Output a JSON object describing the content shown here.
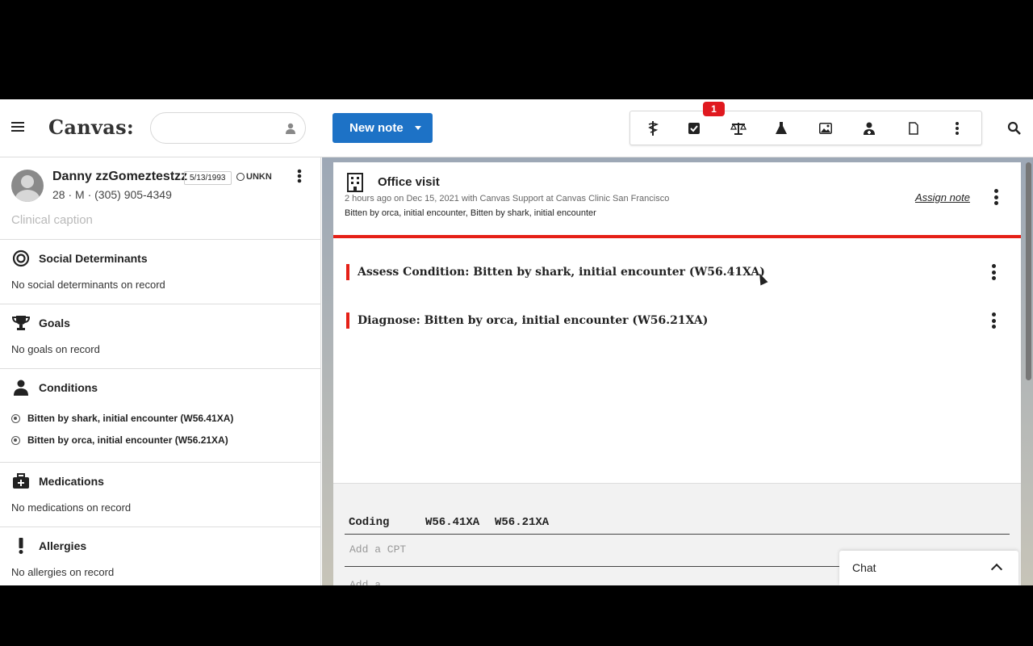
{
  "header": {
    "logo": "Canvas:",
    "search_placeholder": "",
    "new_note_label": "New note",
    "badge_count": "1",
    "toolbar_icons": [
      "caduceus-icon",
      "checkbox-icon",
      "scale-icon",
      "flask-icon",
      "image-icon",
      "doctor-icon",
      "document-icon",
      "more-vert-icon"
    ]
  },
  "patient": {
    "name": "Danny zzGomeztestzz",
    "dob": "5/13/1993",
    "status": "UNKN",
    "meta": "28 · M · (305) 905-4349",
    "caption": "Clinical caption"
  },
  "sections": {
    "social": {
      "title": "Social Determinants",
      "empty": "No social determinants on record"
    },
    "goals": {
      "title": "Goals",
      "empty": "No goals on record"
    },
    "conditions": {
      "title": "Conditions",
      "items": [
        "Bitten by shark, initial encounter (W56.41XA)",
        "Bitten by orca, initial encounter (W56.21XA)"
      ]
    },
    "medications": {
      "title": "Medications",
      "empty": "No medications on record"
    },
    "allergies": {
      "title": "Allergies",
      "empty": "No allergies on record"
    }
  },
  "note": {
    "title": "Office visit",
    "subtitle": "2 hours ago on Dec 15, 2021 with Canvas Support at Canvas Clinic San Francisco",
    "conditions": "Bitten by orca, initial encounter, Bitten by shark, initial encounter",
    "assign_label": "Assign note",
    "commands": [
      "Assess Condition: Bitten by shark, initial encounter  (W56.41XA)",
      "Diagnose: Bitten by orca, initial encounter  (W56.21XA)"
    ],
    "coding_label": "Coding",
    "codes": [
      "W56.41XA",
      "W56.21XA"
    ],
    "cpt_placeholder": "Add a CPT",
    "cut_text": "Add a ..."
  },
  "chat": {
    "label": "Chat"
  },
  "colors": {
    "primary": "#1d72c6",
    "accent_red": "#e52017",
    "badge_red": "#e0191f"
  }
}
